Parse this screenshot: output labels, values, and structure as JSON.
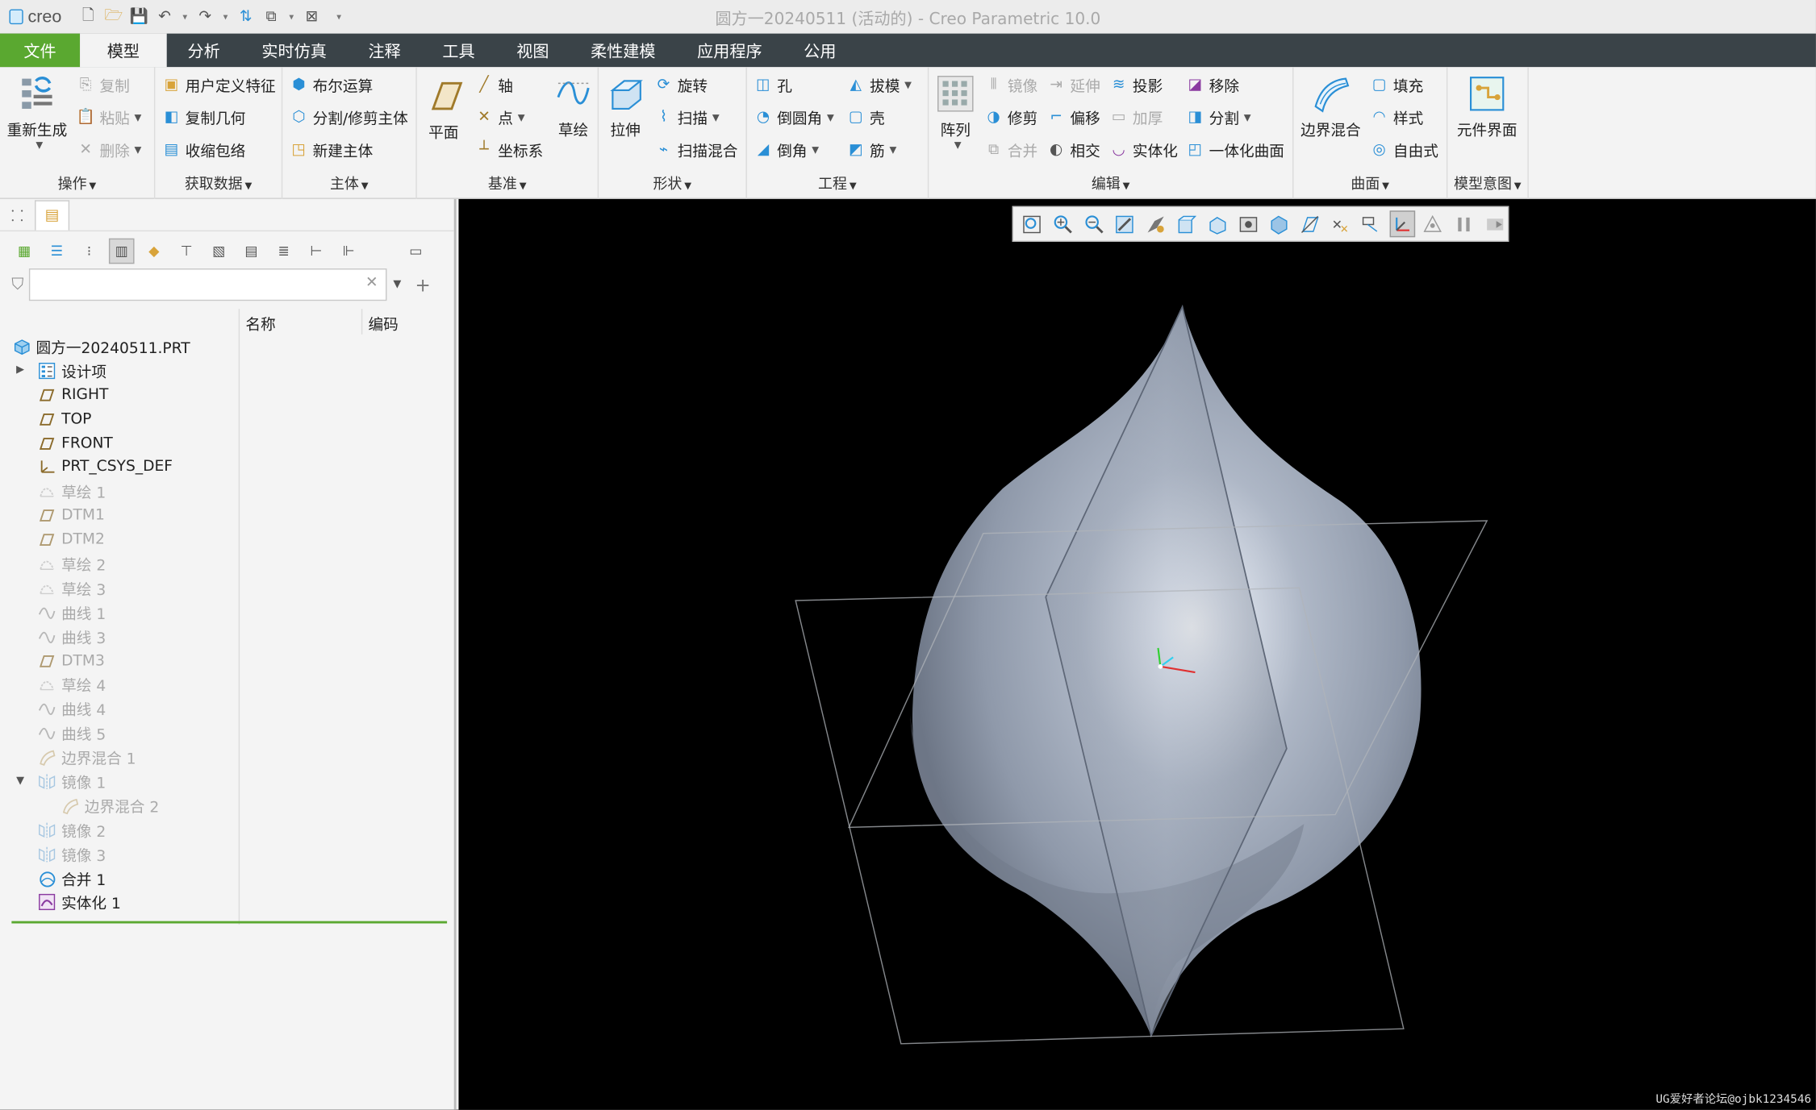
{
  "app": {
    "window_title": "圆方一20240511 (活动的) - Creo Parametric 10.0",
    "logo_text": "creo"
  },
  "tabs": [
    "文件",
    "模型",
    "分析",
    "实时仿真",
    "注释",
    "工具",
    "视图",
    "柔性建模",
    "应用程序",
    "公用"
  ],
  "ribbon": {
    "operations": {
      "label": "操作",
      "regenerate": "重新生成",
      "copy": "复制",
      "paste": "粘贴",
      "delete": "删除"
    },
    "get_data": {
      "label": "获取数据",
      "udf": "用户定义特征",
      "copy_geom": "复制几何",
      "shrinkwrap": "收缩包络"
    },
    "body": {
      "label": "主体",
      "boolean": "布尔运算",
      "split_trim": "分割/修剪主体",
      "new_body": "新建主体"
    },
    "datum": {
      "label": "基准",
      "plane": "平面",
      "axis": "轴",
      "point": "点",
      "csys": "坐标系",
      "sketch": "草绘"
    },
    "shapes": {
      "label": "形状",
      "extrude": "拉伸",
      "revolve": "旋转",
      "sweep": "扫描",
      "swept_blend": "扫描混合"
    },
    "engineering": {
      "label": "工程",
      "hole": "孔",
      "round": "倒圆角",
      "chamfer": "倒角",
      "draft": "拔模",
      "shell": "壳",
      "rib": "筋"
    },
    "editing": {
      "label": "编辑",
      "pattern": "阵列",
      "mirror": "镜像",
      "extend": "延伸",
      "project": "投影",
      "move": "移除",
      "trim": "修剪",
      "offset": "偏移",
      "thicken": "加厚",
      "split": "分割",
      "merge": "合并",
      "intersect": "相交",
      "solidify": "实体化",
      "unify": "一体化曲面"
    },
    "surfaces": {
      "label": "曲面",
      "boundary_blend": "边界混合",
      "fill": "填充",
      "style": "样式",
      "freestyle": "自由式"
    },
    "model_intent": {
      "label": "模型意图",
      "component_interface": "元件界面"
    }
  },
  "tree": {
    "filter_placeholder": "",
    "columns": [
      "名称",
      "编码"
    ],
    "items": [
      {
        "label": "圆方一20240511.PRT",
        "icon": "part-icon",
        "dim": false,
        "indent": 0
      },
      {
        "label": "设计项",
        "icon": "design-items-icon",
        "dim": false,
        "indent": 1,
        "expander": "collapsed"
      },
      {
        "label": "RIGHT",
        "icon": "datum-plane-icon",
        "dim": false,
        "indent": 1
      },
      {
        "label": "TOP",
        "icon": "datum-plane-icon",
        "dim": false,
        "indent": 1
      },
      {
        "label": "FRONT",
        "icon": "datum-plane-icon",
        "dim": false,
        "indent": 1
      },
      {
        "label": "PRT_CSYS_DEF",
        "icon": "csys-icon",
        "dim": false,
        "indent": 1
      },
      {
        "label": "草绘 1",
        "icon": "sketch-icon",
        "dim": true,
        "indent": 1
      },
      {
        "label": "DTM1",
        "icon": "datum-plane-icon",
        "dim": true,
        "indent": 1
      },
      {
        "label": "DTM2",
        "icon": "datum-plane-icon",
        "dim": true,
        "indent": 1
      },
      {
        "label": "草绘 2",
        "icon": "sketch-icon",
        "dim": true,
        "indent": 1
      },
      {
        "label": "草绘 3",
        "icon": "sketch-icon",
        "dim": true,
        "indent": 1
      },
      {
        "label": "曲线 1",
        "icon": "curve-icon",
        "dim": true,
        "indent": 1
      },
      {
        "label": "曲线 3",
        "icon": "curve-icon",
        "dim": true,
        "indent": 1
      },
      {
        "label": "DTM3",
        "icon": "datum-plane-icon",
        "dim": true,
        "indent": 1
      },
      {
        "label": "草绘 4",
        "icon": "sketch-icon",
        "dim": true,
        "indent": 1
      },
      {
        "label": "曲线 4",
        "icon": "curve-icon",
        "dim": true,
        "indent": 1
      },
      {
        "label": "曲线 5",
        "icon": "curve-icon",
        "dim": true,
        "indent": 1
      },
      {
        "label": "边界混合 1",
        "icon": "boundary-blend-icon",
        "dim": true,
        "indent": 1
      },
      {
        "label": "镜像 1",
        "icon": "mirror-icon",
        "dim": true,
        "indent": 1,
        "expander": "expanded"
      },
      {
        "label": "边界混合 2",
        "icon": "boundary-blend-icon",
        "dim": true,
        "indent": 2
      },
      {
        "label": "镜像 2",
        "icon": "mirror-icon",
        "dim": true,
        "indent": 1
      },
      {
        "label": "镜像 3",
        "icon": "mirror-icon",
        "dim": true,
        "indent": 1
      },
      {
        "label": "合并 1",
        "icon": "merge-icon",
        "dim": false,
        "indent": 1
      },
      {
        "label": "实体化 1",
        "icon": "solidify-icon",
        "dim": false,
        "indent": 1
      }
    ]
  },
  "watermark": "UG爱好者论坛@ojbk1234546",
  "colors": {
    "accent_green": "#5aa830",
    "tabbar": "#3a4348",
    "viewport_bg": "#000000",
    "model_surface": "#aab3c2"
  }
}
